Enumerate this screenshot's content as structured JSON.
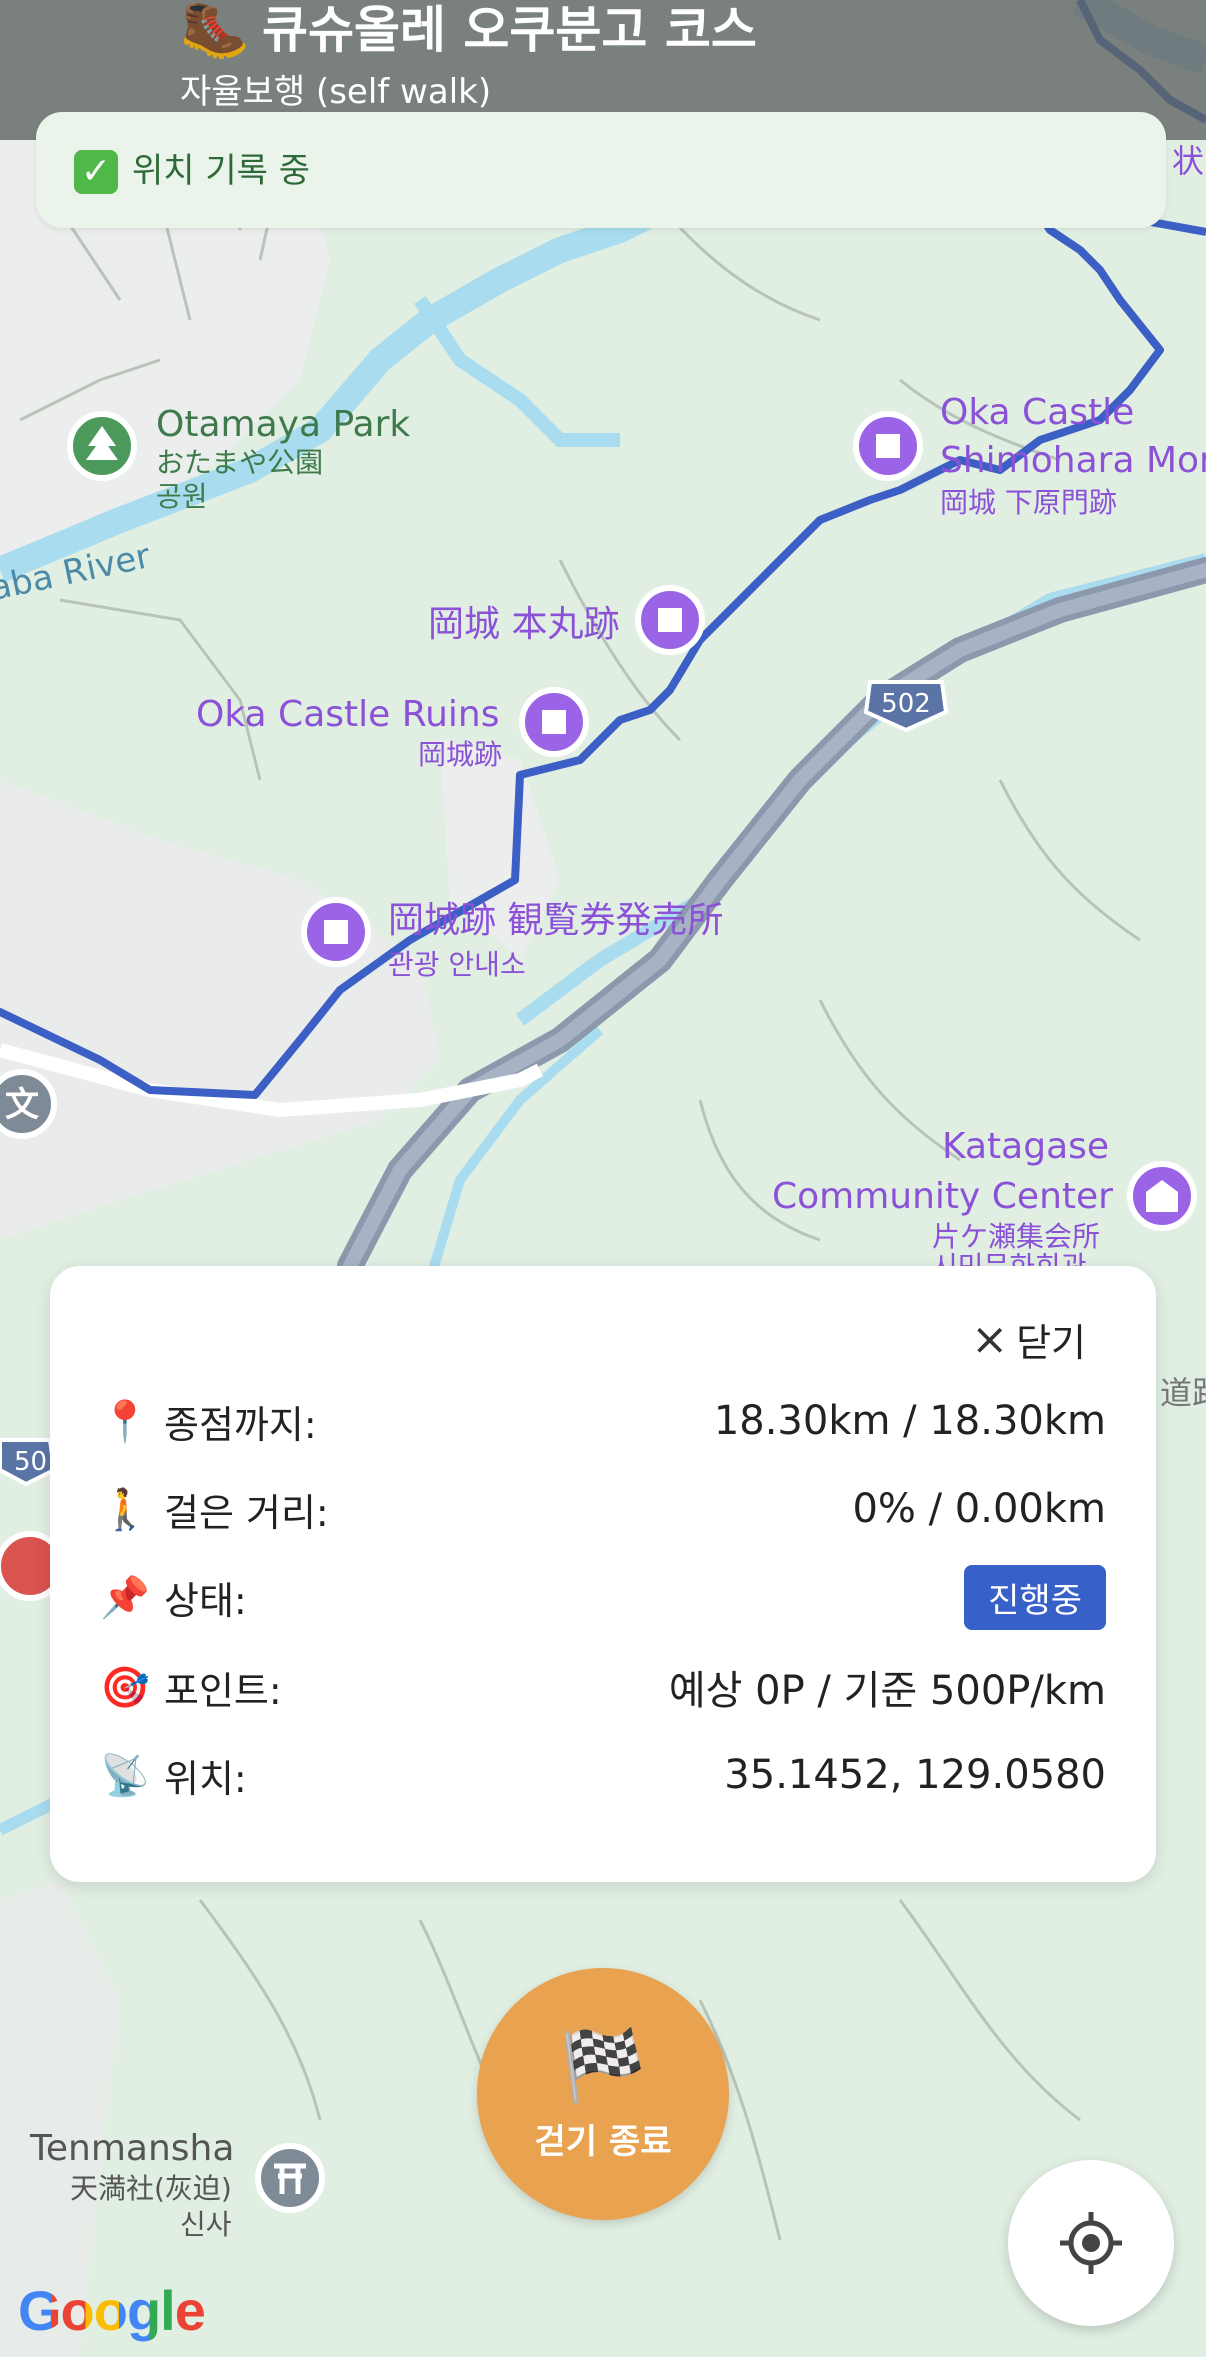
{
  "header": {
    "title": "큐슈올레 오쿠분고 코스",
    "subtitle": "자율보행 (self walk)",
    "hiker_icon": "hiking-boot-icon"
  },
  "banner": {
    "text": "위치 기록 중",
    "icon": "check-mark-icon"
  },
  "map": {
    "labels": {
      "otamaya_en": "Otamaya Park",
      "otamaya_jp": "おたまや公園",
      "otamaya_ko": "공원",
      "river": "aba River",
      "oka_shimohara_1": "Oka Castle",
      "oka_shimohara_2": "Shimohara Mon",
      "oka_shimohara_jp": "岡城 下原門跡",
      "honmaru": "岡城 本丸跡",
      "oka_ruins_en": "Oka Castle Ruins",
      "oka_ruins_jp": "岡城跡",
      "ticket_jp": "岡城跡 観覧券発売所",
      "ticket_ko": "관광 안내소",
      "katagase_1": "Katagase",
      "katagase_2": "Community Center",
      "katagase_jp": "片ケ瀬集会所",
      "katagase_ko": "시민문화회관",
      "route502": "502",
      "route50x": "50",
      "road_jp": "道路",
      "tenmansha_en": "Tenmansha",
      "tenmansha_jp": "天満社(灰迫)",
      "tenmansha_ko": "신사",
      "school_glyph": "文",
      "top_right_jp": "状"
    },
    "attribution": "Google"
  },
  "card": {
    "close_label": "닫기",
    "rows": [
      {
        "icon": "📍",
        "label": "종점까지:",
        "value": "18.30km / 18.30km"
      },
      {
        "icon": "🚶",
        "label": "걸은 거리:",
        "value": "0% / 0.00km"
      },
      {
        "icon": "📌",
        "label": "상태:",
        "value": "진행중"
      },
      {
        "icon": "🎯",
        "label": "포인트:",
        "value": "예상 0P / 기준 500P/km"
      },
      {
        "icon": "📡",
        "label": "위치:",
        "value": "35.1452, 129.0580"
      }
    ]
  },
  "end_button": {
    "label": "걷기 종료",
    "icon": "🏁"
  },
  "colors": {
    "route": "#3b5fc4",
    "poi_purple": "#9b63e6",
    "park_green": "#4c9a5b",
    "end_button": "#e9a24f",
    "badge": "#3761c8"
  }
}
